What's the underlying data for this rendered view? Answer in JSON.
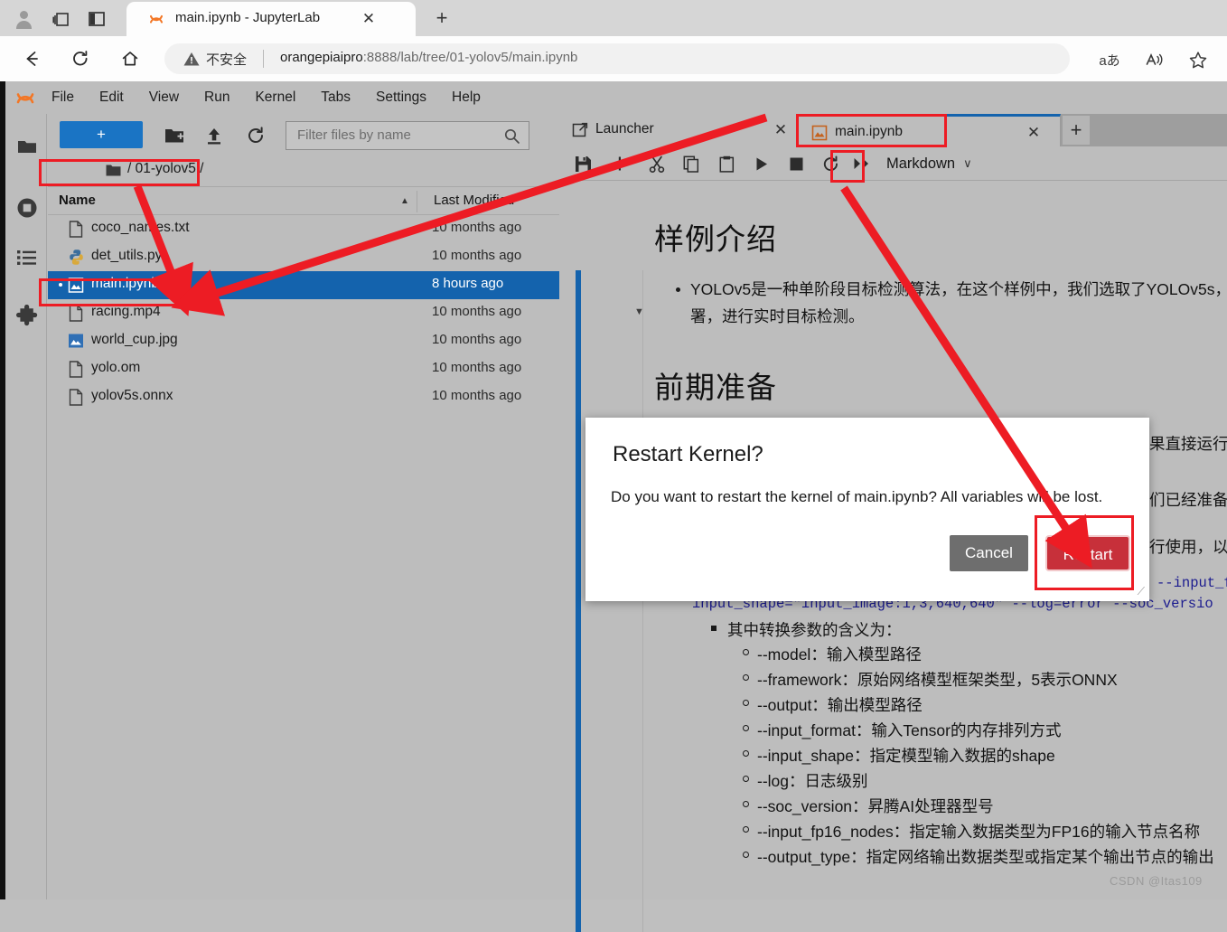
{
  "browser": {
    "icons": {
      "avatar": "avatar-icon",
      "collections": "collections-icon",
      "split_screen": "split-screen-icon",
      "back": "back-arrow-icon",
      "reload": "reload-icon",
      "home": "home-icon",
      "warning": "warning-triangle-icon",
      "translate": "translate-icon",
      "read_aloud": "read-aloud-icon",
      "favorite": "star-icon"
    },
    "tab": {
      "title": "main.ipynb - JupyterLab",
      "close": "✕",
      "favicon": "jupyter-logo-icon"
    },
    "new_tab": "+",
    "security_label": "不安全",
    "url_host": "orangepiaipro",
    "url_rest": ":8888/lab/tree/01-yolov5/main.ipynb",
    "translate_glyph": "aあ",
    "read_aloud_glyph": "A",
    "favorite_glyph": "☆"
  },
  "jupyter": {
    "menu": [
      "File",
      "Edit",
      "View",
      "Run",
      "Kernel",
      "Tabs",
      "Settings",
      "Help"
    ],
    "sidebar": [
      {
        "name": "file-browser",
        "icon": "folder-icon"
      },
      {
        "name": "running-terminals-and-kernels",
        "icon": "stop-circle-icon"
      },
      {
        "name": "table-of-contents",
        "icon": "list-icon"
      },
      {
        "name": "extension-manager",
        "icon": "puzzle-icon"
      }
    ],
    "file_browser": {
      "new_launcher_label": "+",
      "toolbar_icons": [
        "new-folder-icon",
        "upload-icon",
        "refresh-icon"
      ],
      "filter_placeholder": "Filter files by name",
      "search_glyph": "⚲",
      "breadcrumb": "/ 01-yolov5 /",
      "columns": {
        "name": "Name",
        "modified": "Last Modified"
      },
      "sort_caret": "▲",
      "files": [
        {
          "name": "coco_names.txt",
          "modified": "10 months ago",
          "icon": "text-file-icon",
          "selected": false,
          "running": false
        },
        {
          "name": "det_utils.py",
          "modified": "10 months ago",
          "icon": "python-file-icon",
          "selected": false,
          "running": false
        },
        {
          "name": "main.ipynb",
          "modified": "8 hours ago",
          "icon": "notebook-file-icon",
          "selected": true,
          "running": true
        },
        {
          "name": "racing.mp4",
          "modified": "10 months ago",
          "icon": "text-file-icon",
          "selected": false,
          "running": false
        },
        {
          "name": "world_cup.jpg",
          "modified": "10 months ago",
          "icon": "image-file-icon",
          "selected": false,
          "running": false
        },
        {
          "name": "yolo.om",
          "modified": "10 months ago",
          "icon": "text-file-icon",
          "selected": false,
          "running": false
        },
        {
          "name": "yolov5s.onnx",
          "modified": "10 months ago",
          "icon": "text-file-icon",
          "selected": false,
          "running": false
        }
      ]
    },
    "dock": {
      "tabs": [
        {
          "label": "Launcher",
          "icon": "launcher-icon",
          "active": false,
          "close": "✕"
        },
        {
          "label": "main.ipynb",
          "icon": "notebook-file-icon",
          "active": true,
          "close": "✕"
        }
      ],
      "add_tab": "+"
    },
    "notebook_toolbar": {
      "icons": [
        "save-icon",
        "add-cell-icon",
        "cut-icon",
        "copy-icon",
        "paste-icon",
        "run-icon",
        "stop-icon",
        "restart-kernel-icon",
        "restart-run-all-icon"
      ],
      "cell_type": "Markdown",
      "cell_type_caret": "∨"
    },
    "notebook": {
      "collapse_caret": "▼",
      "heading_1": "样例介绍",
      "bullet_1": "YOLOv5是一种单阶段目标检测算法，在这个样例中，我们选取了YOLOv5s，",
      "bullet_1_line2": "署，进行实时目标检测。",
      "heading_2": "前期准备",
      "hidden_line_1": "果直接运行，",
      "hidden_line_2": "们已经准备",
      "hidden_line_3": "行使用，以",
      "code_fragment_1": "--input_f",
      "code_fragment_2": "input_shape=\"input_image:1,3,640,640\" --log=error --soc_versio",
      "params_heading": "其中转换参数的含义为：",
      "params": [
        "--model：输入模型路径",
        "--framework：原始网络模型框架类型，5表示ONNX",
        "--output：输出模型路径",
        "--input_format：输入Tensor的内存排列方式",
        "--input_shape：指定模型输入数据的shape",
        "--log：日志级别",
        "--soc_version：昇腾AI处理器型号",
        "--input_fp16_nodes：指定输入数据类型为FP16的输入节点名称",
        "--output_type：指定网络输出数据类型或指定某个输出节点的输出"
      ]
    },
    "dialog": {
      "title": "Restart Kernel?",
      "body": "Do you want to restart the kernel of main.ipynb? All variables will be lost.",
      "cancel_label": "Cancel",
      "confirm_label": "Restart"
    }
  },
  "annotations": {
    "highlight_color": "#ed1c24",
    "boxes": [
      "breadcrumb-path",
      "main-ipynb-file-row",
      "main-ipynb-dock-tab",
      "restart-run-all-button",
      "restart-confirm-button"
    ]
  },
  "watermark": "CSDN @Itas109",
  "colors": {
    "accent_blue": "#1463ad",
    "danger_red": "#c7303a",
    "annotation_red": "#ed1c24",
    "jupyter_orange": "#f37726",
    "chrome_bg": "#d6d6d6",
    "panel_bg": "#bdbdbd"
  }
}
